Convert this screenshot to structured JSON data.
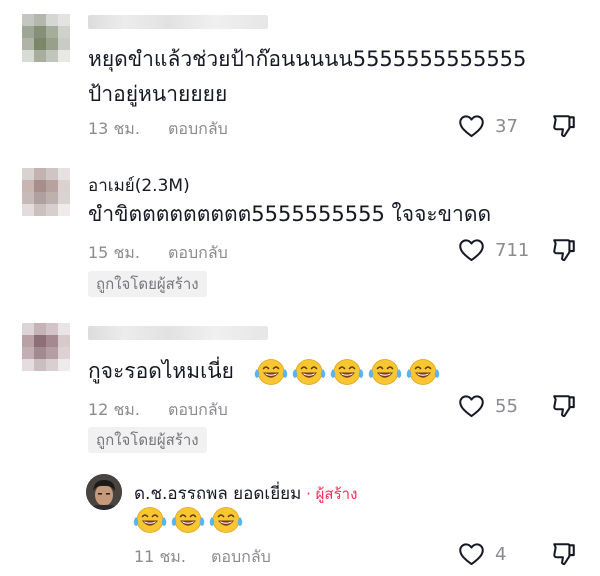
{
  "comments": [
    {
      "username": "",
      "text_line1": "หยุดขำแล้วช่วยป้าก๊อนนนนน5555555555555",
      "text_line2": "ป้าอยู่หนายยยย",
      "time": "13 ชม.",
      "reply_label": "ตอบกลับ",
      "likes": "37"
    },
    {
      "username": "อาเมย์(2.3M)",
      "text_line1": "ขำขิตตตตตตตตต5555555555 ใจจะขาดด",
      "time": "15 ชม.",
      "reply_label": "ตอบกลับ",
      "likes": "711",
      "creator_badge": "ถูกใจโดยผู้สร้าง"
    },
    {
      "username": "",
      "text_line1": "กูจะรอดไหมเนี่ย",
      "emoji_count": 5,
      "time": "12 ชม.",
      "reply_label": "ตอบกลับ",
      "likes": "55",
      "creator_badge": "ถูกใจโดยผู้สร้าง"
    }
  ],
  "reply": {
    "username": "ด.ช.อรรถพล ยอดเยี่ยม",
    "separator": " · ",
    "creator_tag": "ผู้สร้าง",
    "emoji_count": 3,
    "time": "11 ชม.",
    "reply_label": "ตอบกลับ",
    "likes": "4"
  },
  "icons": {
    "like": "heart-outline-icon",
    "dislike": "thumbs-down-icon",
    "emoji": "face-with-tears-of-joy-emoji"
  },
  "colors": {
    "text": "#161823",
    "meta": "#8a8b91",
    "creator_accent": "#fe2c55",
    "badge_bg": "#f1f1f2"
  }
}
